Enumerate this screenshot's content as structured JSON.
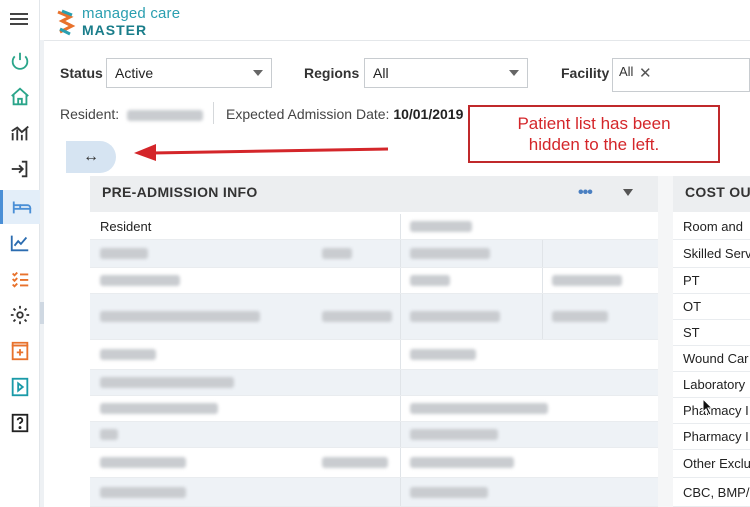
{
  "app": {
    "logo_line1": "managed care",
    "logo_line2": "MASTER"
  },
  "rail": {
    "icons": [
      "menu-icon",
      "power-icon",
      "home-icon",
      "chart-icon",
      "sign-in-icon",
      "bed-icon",
      "trend-icon",
      "checklist-icon",
      "gear-icon",
      "medical-add-icon",
      "play-icon",
      "help-icon"
    ],
    "active": "bed-icon"
  },
  "filters": {
    "status_label": "Status",
    "status_value": "Active",
    "regions_label": "Regions",
    "regions_value": "All",
    "facility_label": "Facility",
    "facility_tag": "All",
    "facility_remove": "✕"
  },
  "resident_bar": {
    "resident_label": "Resident:",
    "admission_label": "Expected Admission Date:",
    "admission_value": "10/01/2019"
  },
  "toggle": {
    "glyph": "↔"
  },
  "callout": {
    "line1": "Patient list has been",
    "line2": "hidden to the left."
  },
  "preadmission": {
    "title": "PRE-ADMISSION INFO",
    "menu": "•••",
    "header_label": "Resident"
  },
  "cost": {
    "title": "COST OU",
    "rows": [
      "Room and",
      "Skilled Serv",
      "PT",
      "OT",
      "ST",
      "Wound Car",
      "Laboratory",
      "Pharmacy I",
      "Pharmacy I",
      "Other Exclu",
      "CBC, BMP/"
    ]
  },
  "colors": {
    "accent": "#4a8fd6",
    "callout": "#d4262a",
    "brand": "#2a9fb0",
    "row_alt": "#eef2f6"
  }
}
